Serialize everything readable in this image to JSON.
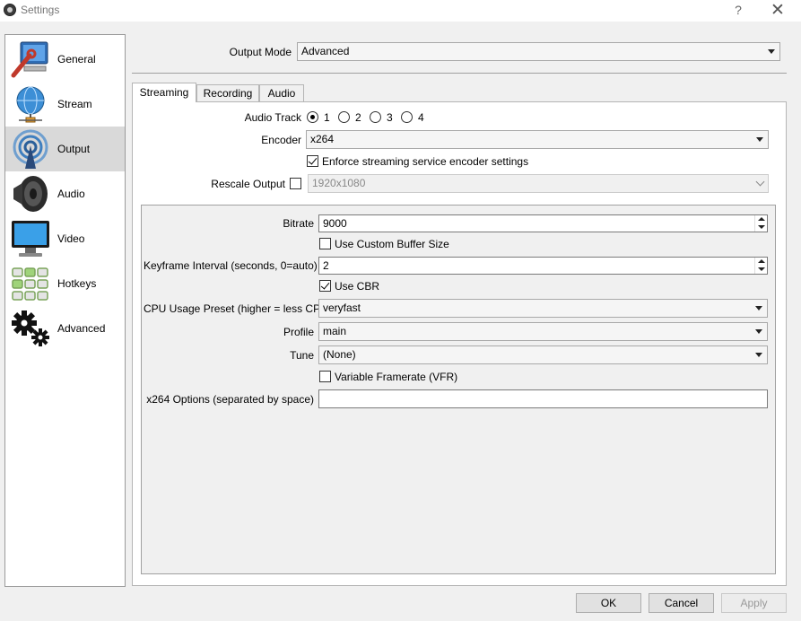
{
  "window": {
    "title": "Settings",
    "help_label": "?",
    "close_label": "✕"
  },
  "sidebar": {
    "items": [
      {
        "label": "General",
        "icon": "computer-wrench-icon"
      },
      {
        "label": "Stream",
        "icon": "globe-network-icon"
      },
      {
        "label": "Output",
        "icon": "broadcast-icon",
        "active": true
      },
      {
        "label": "Audio",
        "icon": "speaker-icon"
      },
      {
        "label": "Video",
        "icon": "monitor-icon"
      },
      {
        "label": "Hotkeys",
        "icon": "keyboard-icon"
      },
      {
        "label": "Advanced",
        "icon": "gears-icon"
      }
    ]
  },
  "output_mode": {
    "label": "Output Mode",
    "value": "Advanced"
  },
  "tabs": [
    "Streaming",
    "Recording",
    "Audio"
  ],
  "streaming": {
    "audio_track": {
      "label": "Audio Track",
      "options": [
        "1",
        "2",
        "3",
        "4"
      ],
      "selected": "1"
    },
    "encoder": {
      "label": "Encoder",
      "value": "x264"
    },
    "enforce": {
      "label": "Enforce streaming service encoder settings",
      "checked": true
    },
    "rescale": {
      "label": "Rescale Output",
      "checked": false,
      "value": "1920x1080"
    }
  },
  "encoder_settings": {
    "bitrate": {
      "label": "Bitrate",
      "value": "9000"
    },
    "custom_buffer": {
      "label": "Use Custom Buffer Size",
      "checked": false
    },
    "keyframe": {
      "label": "Keyframe Interval (seconds, 0=auto)",
      "value": "2"
    },
    "use_cbr": {
      "label": "Use CBR",
      "checked": true
    },
    "cpu_preset": {
      "label": "CPU Usage Preset (higher = less CPU)",
      "value": "veryfast"
    },
    "profile": {
      "label": "Profile",
      "value": "main"
    },
    "tune": {
      "label": "Tune",
      "value": "(None)"
    },
    "vfr": {
      "label": "Variable Framerate (VFR)",
      "checked": false
    },
    "x264_options": {
      "label": "x264 Options (separated by space)",
      "value": ""
    }
  },
  "buttons": {
    "ok": "OK",
    "cancel": "Cancel",
    "apply": "Apply"
  }
}
